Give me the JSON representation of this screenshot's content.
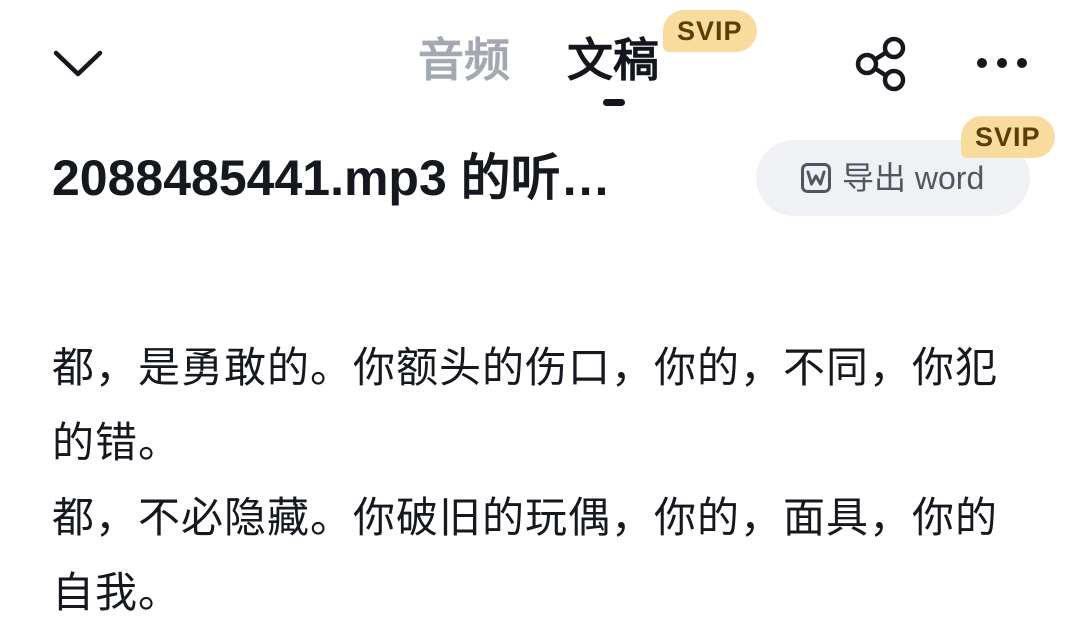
{
  "header": {
    "tabs": [
      {
        "label": "音频",
        "active": false
      },
      {
        "label": "文稿",
        "active": true
      }
    ],
    "vip_badge": "SVIP",
    "icons": {
      "back": "chevron-down-icon",
      "share": "share-icon",
      "more": "more-dots-icon"
    }
  },
  "document": {
    "title": "2088485441.mp3 的听…",
    "export_label": "导出 word",
    "export_icon": "word-file-icon",
    "export_vip_badge": "SVIP"
  },
  "transcript": {
    "paragraphs": [
      "都，是勇敢的。你额头的伤口，你的，不同，你犯的错。",
      "都，不必隐藏。你破旧的玩偶，你的，面具，你的自我。"
    ]
  },
  "colors": {
    "active_tab": "#13161c",
    "inactive_tab": "#a4a8b1",
    "vip_badge_bg": "#f8dc9e",
    "vip_badge_text": "#5a3d08",
    "export_bg": "#f0f1f5"
  }
}
